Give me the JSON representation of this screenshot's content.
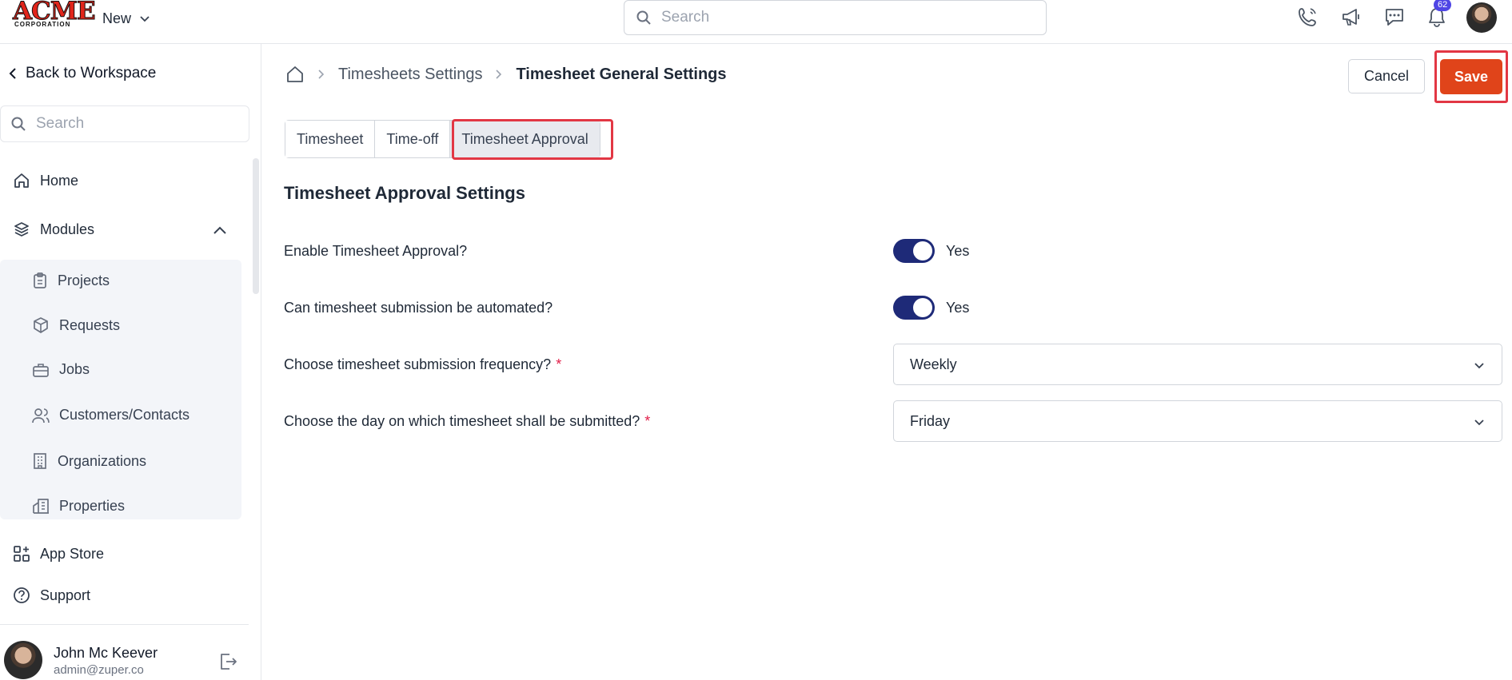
{
  "brand": {
    "name": "ACME",
    "tagline": "CORPORATION"
  },
  "topbar": {
    "new_label": "New",
    "search_placeholder": "Search",
    "notification_count": "62"
  },
  "sidebar": {
    "back_label": "Back to Workspace",
    "search_placeholder": "Search",
    "home_label": "Home",
    "modules_label": "Modules",
    "module_items": [
      "Projects",
      "Requests",
      "Jobs",
      "Customers/Contacts",
      "Organizations",
      "Properties"
    ],
    "app_store_label": "App Store",
    "support_label": "Support",
    "user": {
      "name": "John Mc Keever",
      "email": "admin@zuper.co"
    }
  },
  "header": {
    "breadcrumb": [
      "Timesheets Settings",
      "Timesheet General Settings"
    ],
    "cancel_label": "Cancel",
    "save_label": "Save"
  },
  "tabs": [
    {
      "label": "Timesheet",
      "active": false
    },
    {
      "label": "Time-off",
      "active": false
    },
    {
      "label": "Timesheet Approval",
      "active": true
    }
  ],
  "settings": {
    "title": "Timesheet Approval Settings",
    "enable_approval": {
      "label": "Enable Timesheet Approval?",
      "value": "Yes"
    },
    "automate_submission": {
      "label": "Can timesheet submission be automated?",
      "value": "Yes"
    },
    "frequency": {
      "label": "Choose timesheet submission frequency?",
      "value": "Weekly"
    },
    "submit_day": {
      "label": "Choose the day on which timesheet shall be submitted?",
      "value": "Friday"
    },
    "required_marker": "*"
  },
  "colors": {
    "accent": "#1e2a78",
    "save": "#e0441a",
    "highlight": "#e23744"
  }
}
